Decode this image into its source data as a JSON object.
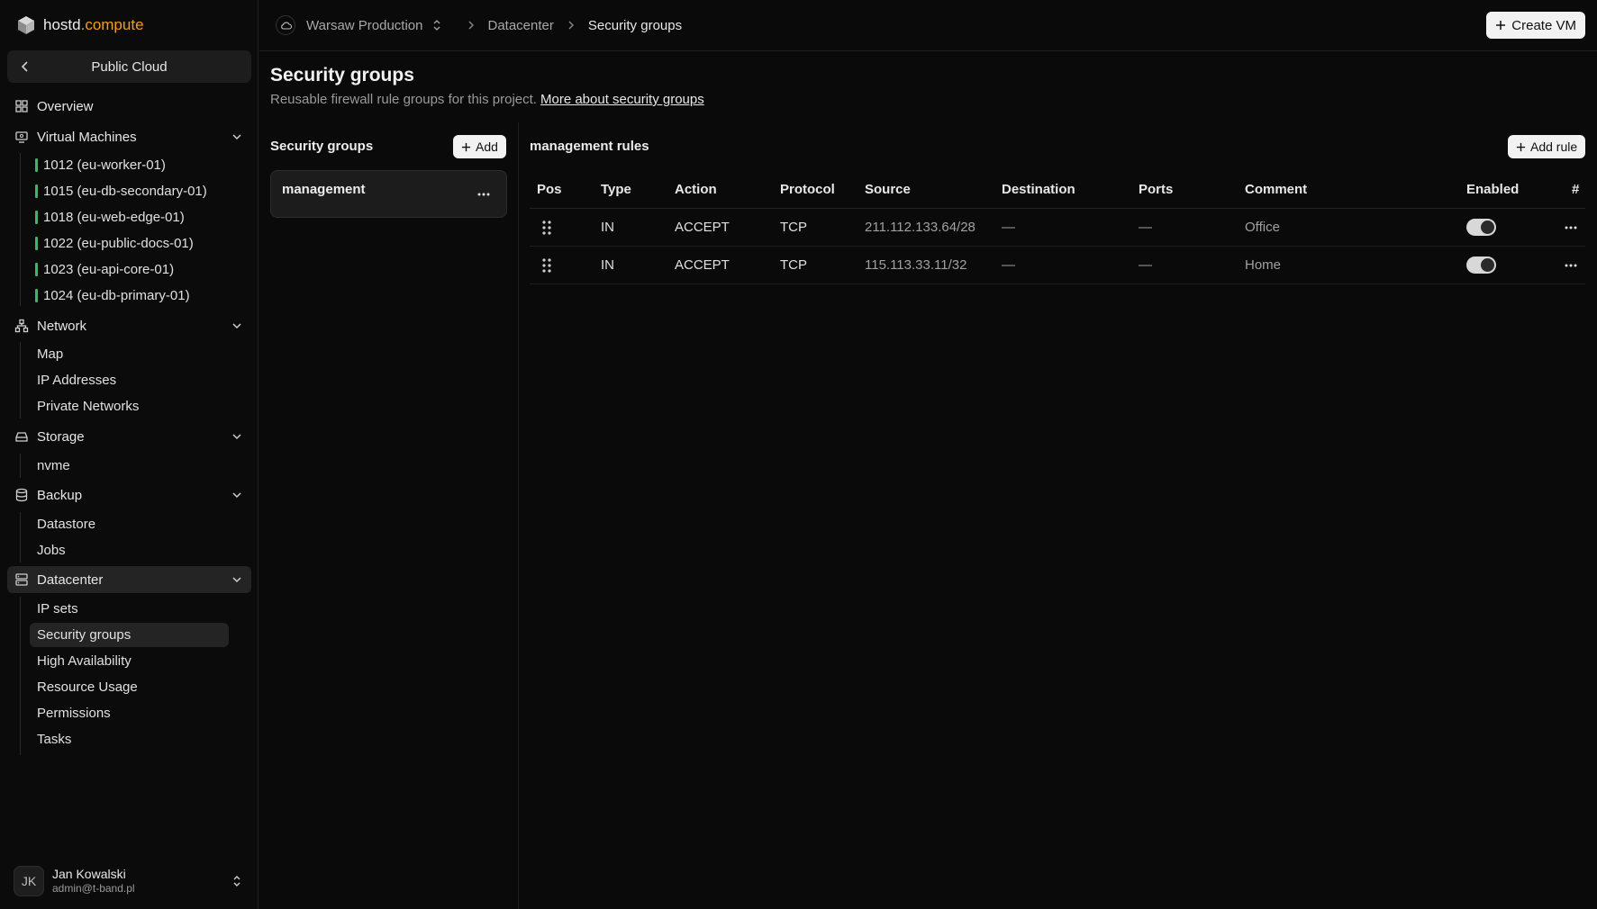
{
  "brand": {
    "host": "hostd",
    "compute": ".compute"
  },
  "sidebar": {
    "cloud_label": "Public Cloud",
    "overview": "Overview",
    "vms": {
      "label": "Virtual Machines",
      "items": [
        "1012 (eu-worker-01)",
        "1015 (eu-db-secondary-01)",
        "1018 (eu-web-edge-01)",
        "1022 (eu-public-docs-01)",
        "1023 (eu-api-core-01)",
        "1024 (eu-db-primary-01)"
      ]
    },
    "network": {
      "label": "Network",
      "items": [
        "Map",
        "IP Addresses",
        "Private Networks"
      ]
    },
    "storage": {
      "label": "Storage",
      "items": [
        "nvme"
      ]
    },
    "backup": {
      "label": "Backup",
      "items": [
        "Datastore",
        "Jobs"
      ]
    },
    "datacenter": {
      "label": "Datacenter",
      "items": [
        "IP sets",
        "Security groups",
        "High Availability",
        "Resource Usage",
        "Permissions",
        "Tasks"
      ]
    },
    "user": {
      "initials": "JK",
      "name": "Jan Kowalski",
      "email": "admin@t-band.pl"
    },
    "status_color": "#22c55e"
  },
  "topbar": {
    "project": "Warsaw Production",
    "crumb1": "Datacenter",
    "crumb2": "Security groups",
    "create_vm": "Create VM"
  },
  "page": {
    "title": "Security groups",
    "subtitle": "Reusable firewall rule groups for this project.",
    "link": "More about security groups"
  },
  "groups": {
    "heading": "Security groups",
    "add_label": "Add",
    "items": [
      "management"
    ]
  },
  "rules": {
    "title": "management rules",
    "add_label": "Add rule",
    "columns": [
      "Pos",
      "Type",
      "Action",
      "Protocol",
      "Source",
      "Destination",
      "Ports",
      "Comment",
      "Enabled",
      "#"
    ],
    "rows": [
      {
        "type": "IN",
        "action": "ACCEPT",
        "protocol": "TCP",
        "source": "211.112.133.64/28",
        "destination": "—",
        "ports": "—",
        "comment": "Office",
        "enabled": true
      },
      {
        "type": "IN",
        "action": "ACCEPT",
        "protocol": "TCP",
        "source": "115.113.33.11/32",
        "destination": "—",
        "ports": "—",
        "comment": "Home",
        "enabled": true
      }
    ]
  },
  "accent_color": "#f59e0b"
}
